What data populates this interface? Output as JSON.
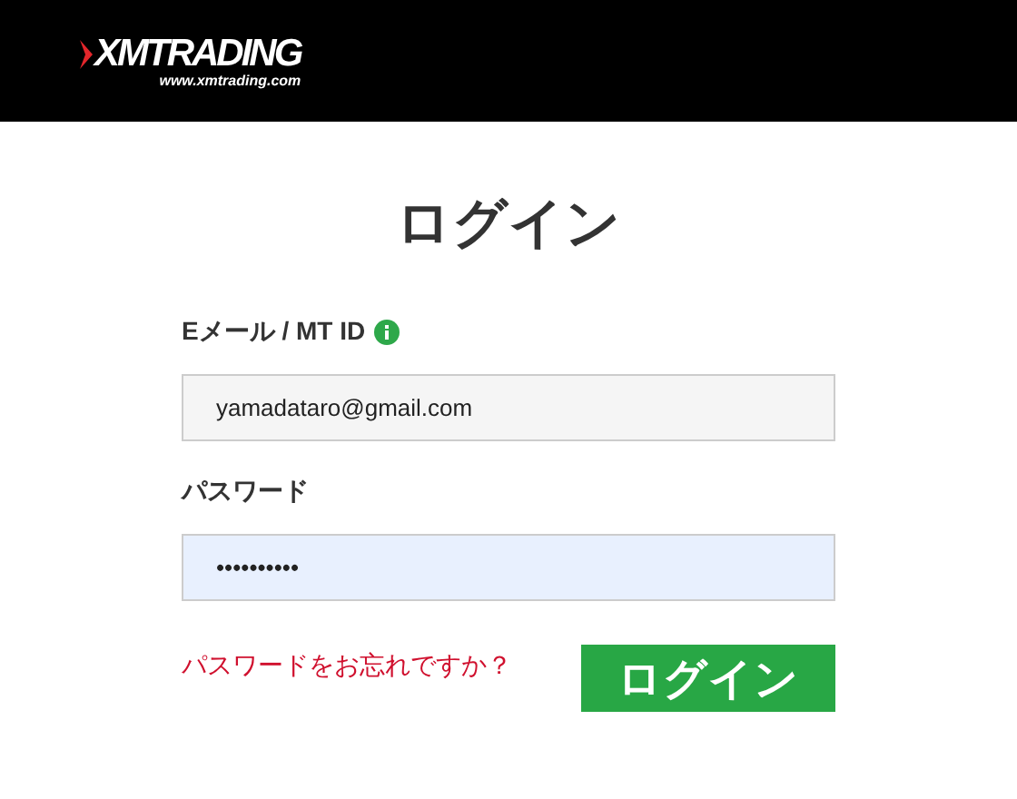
{
  "header": {
    "logo_text": "XMTRADING",
    "logo_url": "www.xmtrading.com"
  },
  "title": "ログイン",
  "fields": [
    {
      "label": "Eメール / MT ID",
      "info": true,
      "value": "yamadataro@gmail.com",
      "focused": false
    },
    {
      "label": "パスワード",
      "info": false,
      "value": "••••••••••",
      "focused": true
    }
  ],
  "forgot_link": "パスワードをお忘れですか？",
  "login_button": "ログイン"
}
